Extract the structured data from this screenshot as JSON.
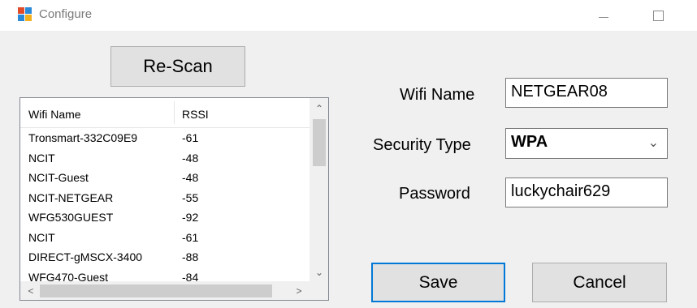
{
  "window": {
    "title": "Configure"
  },
  "toolbar": {
    "rescan_label": "Re-Scan"
  },
  "networks": {
    "columns": [
      "Wifi Name",
      "RSSI"
    ],
    "rows": [
      [
        "Tronsmart-332C09E9",
        "-61"
      ],
      [
        "NCIT",
        "-48"
      ],
      [
        "NCIT-Guest",
        "-48"
      ],
      [
        "NCIT-NETGEAR",
        "-55"
      ],
      [
        "WFG530GUEST",
        "-92"
      ],
      [
        "NCIT",
        "-61"
      ],
      [
        "DIRECT-gMSCX-3400",
        "-88"
      ],
      [
        "WFG470-Guest",
        "-84"
      ]
    ]
  },
  "form": {
    "wifi_name_label": "Wifi Name",
    "wifi_name_value": "NETGEAR08",
    "security_type_label": "Security Type",
    "security_type_value": "WPA",
    "password_label": "Password",
    "password_value": "luckychair629"
  },
  "actions": {
    "save_label": "Save",
    "cancel_label": "Cancel"
  }
}
